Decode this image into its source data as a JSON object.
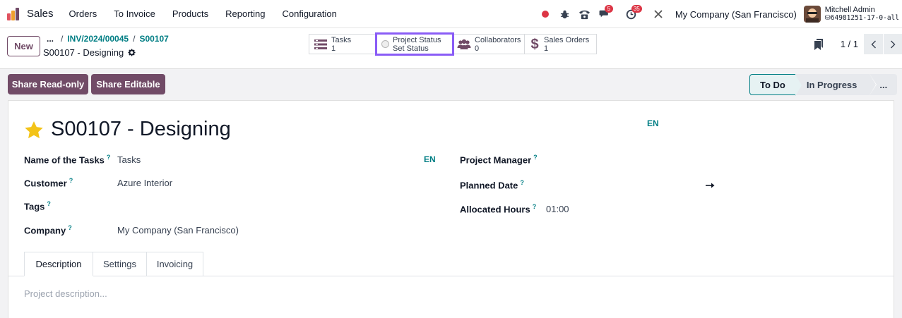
{
  "navbar": {
    "app_name": "Sales",
    "menu": [
      "Orders",
      "To Invoice",
      "Products",
      "Reporting",
      "Configuration"
    ],
    "messages_badge": "5",
    "activities_badge": "35",
    "company": "My Company (San Francisco)",
    "user_name": "Mitchell Admin",
    "database": "64981251-17-0-all",
    "colors": {
      "status_dot": "#dc3545",
      "badge": "#dc3545"
    }
  },
  "control_panel": {
    "new_label": "New",
    "breadcrumb": {
      "dots": "...",
      "items": [
        "INV/2024/00045",
        "S00107"
      ],
      "separator": "/"
    },
    "record_title": "S00107 - Designing",
    "stat_buttons": [
      {
        "icon": "tasks-icon",
        "label": "Tasks",
        "value": "1"
      },
      {
        "icon": "radio-icon",
        "label": "Project Status",
        "value": "Set Status"
      },
      {
        "icon": "users-icon",
        "label": "Collaborators",
        "value": "0"
      },
      {
        "icon": "dollar-icon",
        "label": "Sales Orders",
        "value": "1"
      }
    ],
    "pager": "1 / 1"
  },
  "status_row": {
    "share_readonly": "Share Read-only",
    "share_editable": "Share Editable",
    "stages": [
      "To Do",
      "In Progress",
      "..."
    ],
    "active_stage": "To Do"
  },
  "form": {
    "title": "S00107 - Designing",
    "title_lang": "EN",
    "left_fields": [
      {
        "label": "Name of the Tasks",
        "help": "?",
        "value": "Tasks",
        "lang": "EN"
      },
      {
        "label": "Customer",
        "help": "?",
        "value": "Azure Interior"
      },
      {
        "label": "Tags",
        "help": "?",
        "value": ""
      },
      {
        "label": "Company",
        "help": "?",
        "value": "My Company (San Francisco)"
      }
    ],
    "right_fields": [
      {
        "label": "Project Manager",
        "help": "?",
        "value": ""
      },
      {
        "label": "Planned Date",
        "help": "?",
        "value": ""
      },
      {
        "label": "Allocated Hours",
        "help": "?",
        "value": "01:00"
      }
    ],
    "tabs": [
      "Description",
      "Settings",
      "Invoicing"
    ],
    "active_tab": "Description",
    "description_placeholder": "Project description..."
  },
  "colors": {
    "primary": "#714b67",
    "link": "#017e84",
    "highlight": "#8a5cf6",
    "star": "#f3c318"
  }
}
